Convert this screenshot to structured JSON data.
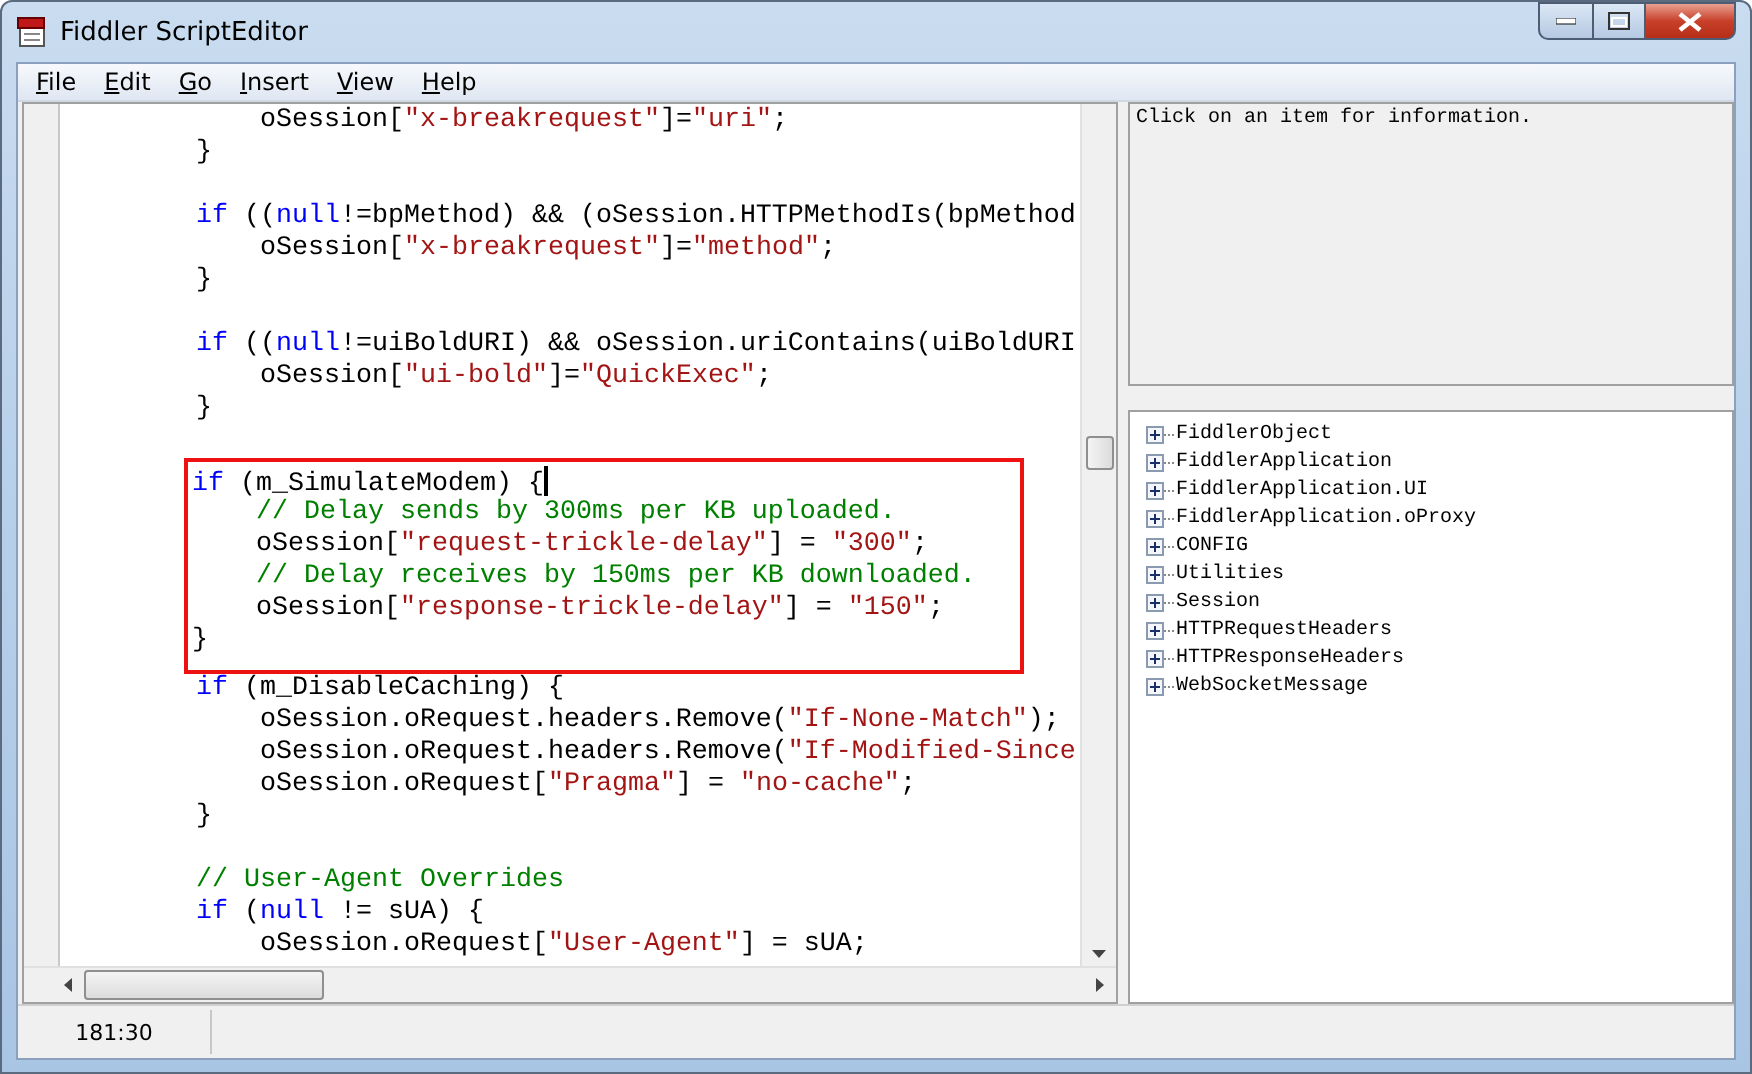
{
  "window": {
    "title": "Fiddler ScriptEditor"
  },
  "menu": [
    {
      "label": "File"
    },
    {
      "label": "Edit"
    },
    {
      "label": "Go"
    },
    {
      "label": "Insert"
    },
    {
      "label": "View"
    },
    {
      "label": "Help"
    }
  ],
  "editor": {
    "lines": [
      {
        "kind": "code",
        "highlighted": false,
        "caret": false,
        "tokens": [
          {
            "kind": "text",
            "text": "            oSession["
          },
          {
            "kind": "str",
            "text": "\"x-breakrequest\""
          },
          {
            "kind": "text",
            "text": "]="
          },
          {
            "kind": "str",
            "text": "\"uri\""
          },
          {
            "kind": "text",
            "text": ";"
          }
        ]
      },
      {
        "kind": "code",
        "highlighted": false,
        "caret": false,
        "tokens": [
          {
            "kind": "text",
            "text": "        }"
          }
        ]
      },
      {
        "kind": "blank"
      },
      {
        "kind": "code",
        "highlighted": false,
        "caret": false,
        "tokens": [
          {
            "kind": "kw",
            "text": "        if"
          },
          {
            "kind": "text",
            "text": " (("
          },
          {
            "kind": "kw",
            "text": "null"
          },
          {
            "kind": "text",
            "text": "!=bpMethod) && (oSession.HTTPMethodIs(bpMethod"
          }
        ]
      },
      {
        "kind": "code",
        "highlighted": false,
        "caret": false,
        "tokens": [
          {
            "kind": "text",
            "text": "            oSession["
          },
          {
            "kind": "str",
            "text": "\"x-breakrequest\""
          },
          {
            "kind": "text",
            "text": "]="
          },
          {
            "kind": "str",
            "text": "\"method\""
          },
          {
            "kind": "text",
            "text": ";"
          }
        ]
      },
      {
        "kind": "code",
        "highlighted": false,
        "caret": false,
        "tokens": [
          {
            "kind": "text",
            "text": "        }"
          }
        ]
      },
      {
        "kind": "blank"
      },
      {
        "kind": "code",
        "highlighted": false,
        "caret": false,
        "tokens": [
          {
            "kind": "kw",
            "text": "        if"
          },
          {
            "kind": "text",
            "text": " (("
          },
          {
            "kind": "kw",
            "text": "null"
          },
          {
            "kind": "text",
            "text": "!=uiBoldURI) && oSession.uriContains(uiBoldURI"
          }
        ]
      },
      {
        "kind": "code",
        "highlighted": false,
        "caret": false,
        "tokens": [
          {
            "kind": "text",
            "text": "            oSession["
          },
          {
            "kind": "str",
            "text": "\"ui-bold\""
          },
          {
            "kind": "text",
            "text": "]="
          },
          {
            "kind": "str",
            "text": "\"QuickExec\""
          },
          {
            "kind": "text",
            "text": ";"
          }
        ]
      },
      {
        "kind": "code",
        "highlighted": false,
        "caret": false,
        "tokens": [
          {
            "kind": "text",
            "text": "        }"
          }
        ]
      },
      {
        "kind": "blank"
      },
      {
        "kind": "code",
        "highlighted": true,
        "caret": true,
        "tokens": [
          {
            "kind": "kw",
            "text": "        if"
          },
          {
            "kind": "text",
            "text": " (m_SimulateModem) {"
          }
        ]
      },
      {
        "kind": "code",
        "highlighted": true,
        "caret": false,
        "tokens": [
          {
            "kind": "cmt",
            "text": "            // Delay sends by 300ms per KB uploaded."
          }
        ]
      },
      {
        "kind": "code",
        "highlighted": true,
        "caret": false,
        "tokens": [
          {
            "kind": "text",
            "text": "            oSession["
          },
          {
            "kind": "str",
            "text": "\"request-trickle-delay\""
          },
          {
            "kind": "text",
            "text": "] = "
          },
          {
            "kind": "str",
            "text": "\"300\""
          },
          {
            "kind": "text",
            "text": ";"
          }
        ]
      },
      {
        "kind": "code",
        "highlighted": true,
        "caret": false,
        "tokens": [
          {
            "kind": "cmt",
            "text": "            // Delay receives by 150ms per KB downloaded."
          }
        ]
      },
      {
        "kind": "code",
        "highlighted": true,
        "caret": false,
        "tokens": [
          {
            "kind": "text",
            "text": "            oSession["
          },
          {
            "kind": "str",
            "text": "\"response-trickle-delay\""
          },
          {
            "kind": "text",
            "text": "] = "
          },
          {
            "kind": "str",
            "text": "\"150\""
          },
          {
            "kind": "text",
            "text": ";"
          }
        ]
      },
      {
        "kind": "code",
        "highlighted": true,
        "caret": false,
        "tokens": [
          {
            "kind": "text",
            "text": "        }"
          }
        ]
      },
      {
        "kind": "code",
        "highlighted": false,
        "caret": false,
        "tokens": [
          {
            "kind": "kw",
            "text": "        if"
          },
          {
            "kind": "text",
            "text": " (m_DisableCaching) {"
          }
        ]
      },
      {
        "kind": "code",
        "highlighted": false,
        "caret": false,
        "tokens": [
          {
            "kind": "text",
            "text": "            oSession.oRequest.headers.Remove("
          },
          {
            "kind": "str",
            "text": "\"If-None-Match\""
          },
          {
            "kind": "text",
            "text": ");"
          }
        ]
      },
      {
        "kind": "code",
        "highlighted": false,
        "caret": false,
        "tokens": [
          {
            "kind": "text",
            "text": "            oSession.oRequest.headers.Remove("
          },
          {
            "kind": "str",
            "text": "\"If-Modified-Since"
          }
        ]
      },
      {
        "kind": "code",
        "highlighted": false,
        "caret": false,
        "tokens": [
          {
            "kind": "text",
            "text": "            oSession.oRequest["
          },
          {
            "kind": "str",
            "text": "\"Pragma\""
          },
          {
            "kind": "text",
            "text": "] = "
          },
          {
            "kind": "str",
            "text": "\"no-cache\""
          },
          {
            "kind": "text",
            "text": ";"
          }
        ]
      },
      {
        "kind": "code",
        "highlighted": false,
        "caret": false,
        "tokens": [
          {
            "kind": "text",
            "text": "        }"
          }
        ]
      },
      {
        "kind": "blank"
      },
      {
        "kind": "code",
        "highlighted": false,
        "caret": false,
        "tokens": [
          {
            "kind": "cmt",
            "text": "        // User-Agent Overrides"
          }
        ]
      },
      {
        "kind": "code",
        "highlighted": false,
        "caret": false,
        "tokens": [
          {
            "kind": "kw",
            "text": "        if"
          },
          {
            "kind": "text",
            "text": " ("
          },
          {
            "kind": "kw",
            "text": "null"
          },
          {
            "kind": "text",
            "text": " != sUA) {"
          }
        ]
      },
      {
        "kind": "code",
        "highlighted": false,
        "caret": false,
        "tokens": [
          {
            "kind": "text",
            "text": "            oSession.oRequest["
          },
          {
            "kind": "str",
            "text": "\"User-Agent\""
          },
          {
            "kind": "text",
            "text": "] = sUA;"
          }
        ]
      }
    ]
  },
  "info_panel": {
    "text": "Click on an item for information."
  },
  "tree": [
    {
      "label": "FiddlerObject",
      "expanded": false
    },
    {
      "label": "FiddlerApplication",
      "expanded": false
    },
    {
      "label": "FiddlerApplication.UI",
      "expanded": false
    },
    {
      "label": "FiddlerApplication.oProxy",
      "expanded": false
    },
    {
      "label": "CONFIG",
      "expanded": false
    },
    {
      "label": "Utilities",
      "expanded": false
    },
    {
      "label": "Session",
      "expanded": false
    },
    {
      "label": "HTTPRequestHeaders",
      "expanded": false
    },
    {
      "label": "HTTPResponseHeaders",
      "expanded": false
    },
    {
      "label": "WebSocketMessage",
      "expanded": false
    }
  ],
  "status_bar": {
    "position": "181:30"
  }
}
